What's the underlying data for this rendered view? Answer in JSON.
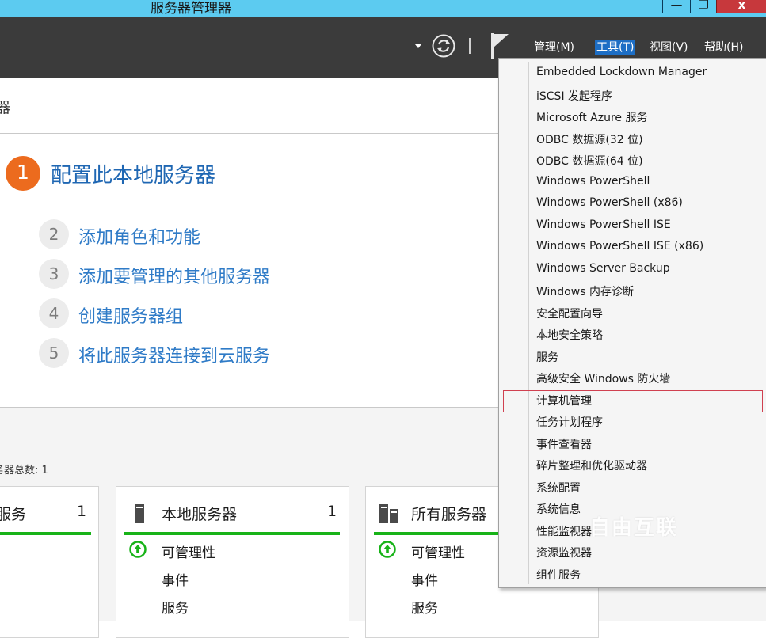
{
  "window": {
    "title": "服务器管理器",
    "minimize_glyph": "—",
    "maximize_glyph": "❐",
    "close_glyph": "x"
  },
  "toolbar": {
    "menus": [
      {
        "label": "管理(M)",
        "active": false
      },
      {
        "label": "工具(T)",
        "active": true
      },
      {
        "label": "视图(V)",
        "active": false
      },
      {
        "label": "帮助(H)",
        "active": false
      }
    ],
    "icons": [
      "dropdown-arrow-icon",
      "refresh-icon",
      "flag-icon"
    ]
  },
  "main": {
    "section_fragment": "器",
    "steps": [
      {
        "num": "1",
        "label": "配置此本地服务器"
      },
      {
        "num": "2",
        "label": "添加角色和功能"
      },
      {
        "num": "3",
        "label": "添加要管理的其他服务器"
      },
      {
        "num": "4",
        "label": "创建服务器组"
      },
      {
        "num": "5",
        "label": "将此服务器连接到云服务"
      }
    ],
    "total_label": "务器总数: 1"
  },
  "cards": [
    {
      "title": "服务",
      "count": "1",
      "rows": []
    },
    {
      "title": "本地服务器",
      "count": "1",
      "rows": [
        "可管理性",
        "事件",
        "服务"
      ]
    },
    {
      "title": "所有服务器",
      "count": "",
      "rows": [
        "可管理性",
        "事件",
        "服务"
      ]
    }
  ],
  "tools_menu": {
    "items": [
      "Embedded Lockdown Manager",
      "iSCSI 发起程序",
      "Microsoft Azure 服务",
      "ODBC 数据源(32 位)",
      "ODBC 数据源(64 位)",
      "Windows PowerShell",
      "Windows PowerShell (x86)",
      "Windows PowerShell ISE",
      "Windows PowerShell ISE (x86)",
      "Windows Server Backup",
      "Windows 内存诊断",
      "安全配置向导",
      "本地安全策略",
      "服务",
      "高级安全 Windows 防火墙",
      "计算机管理",
      "任务计划程序",
      "事件查看器",
      "碎片整理和优化驱动器",
      "系统配置",
      "系统信息",
      "性能监视器",
      "资源监视器",
      "组件服务"
    ],
    "highlighted": "计算机管理"
  },
  "watermark": "自由互联",
  "colors": {
    "titlebar": "#5ccbf0",
    "toolbar": "#3b3b3b",
    "accent_orange": "#ec6b1e",
    "link_blue": "#2f7bc7",
    "status_green": "#18b318",
    "menu_active": "#1d6ec5",
    "highlight_border": "#d04050"
  }
}
